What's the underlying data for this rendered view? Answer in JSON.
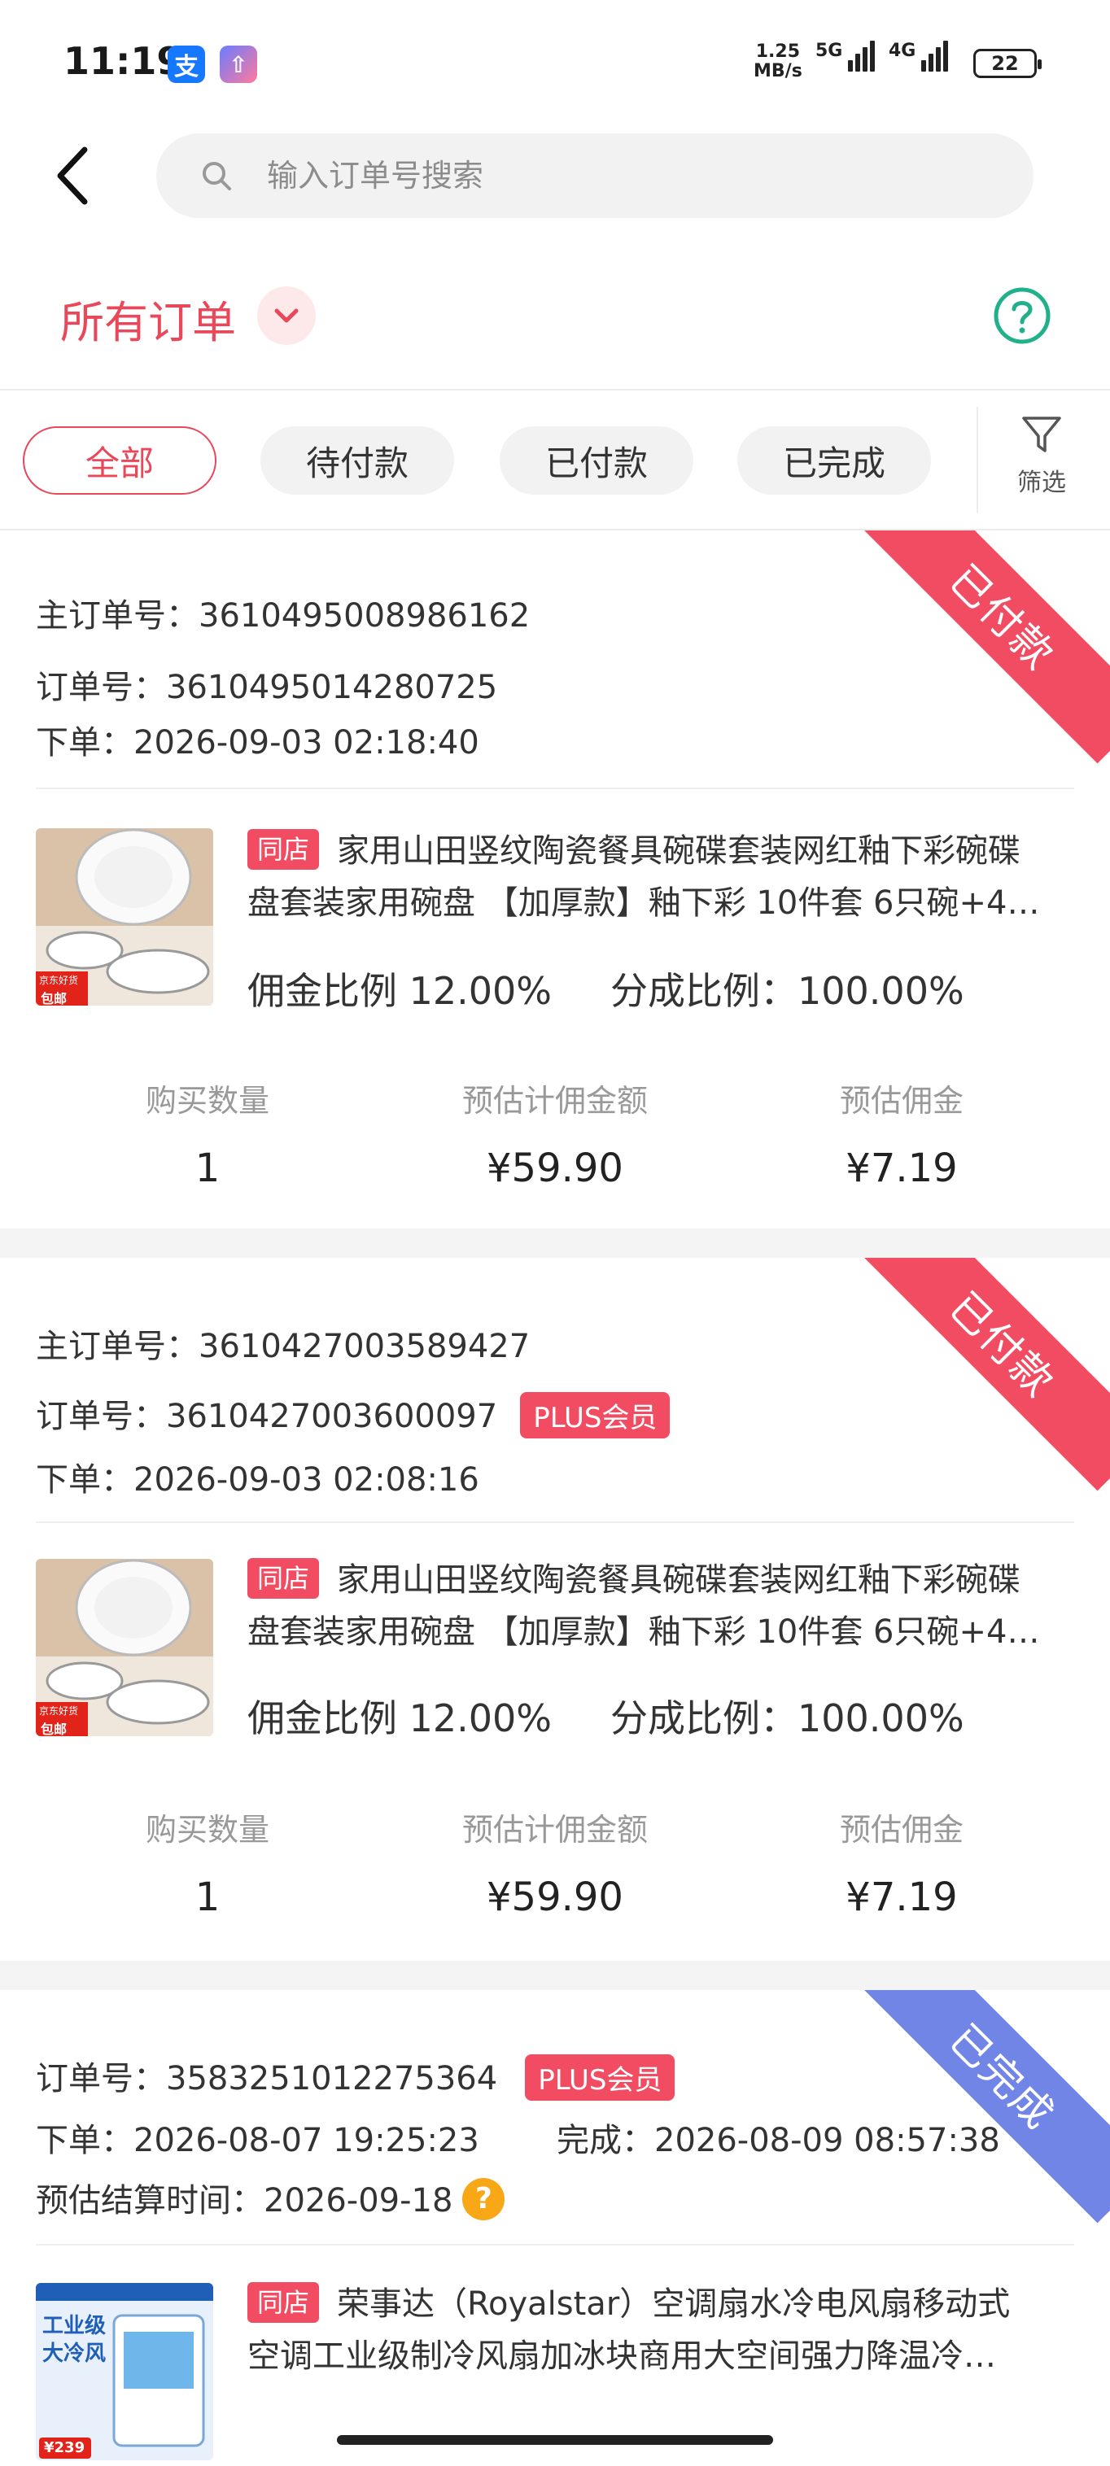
{
  "status_bar": {
    "time": "11:19",
    "alipay_icon_glyph": "支",
    "upload_icon_glyph": "⇧",
    "net_speed_value": "1.25",
    "net_speed_unit": "MB/s",
    "signal1_label": "5G",
    "signal2_label": "4G",
    "battery": "22"
  },
  "search": {
    "placeholder": "输入订单号搜索"
  },
  "header": {
    "title": "所有订单"
  },
  "tabs": [
    {
      "label": "全部",
      "active": true
    },
    {
      "label": "待付款",
      "active": false
    },
    {
      "label": "已付款",
      "active": false
    },
    {
      "label": "已完成",
      "active": false
    }
  ],
  "filter": {
    "label": "筛选"
  },
  "orders": [
    {
      "status": "已付款",
      "main_order": "主订单号：3610495008986162",
      "order_no": "订单号：3610495014280725",
      "placed": "下单：2026-09-03 02:18:40",
      "shop_tag": "同店",
      "product_line1": "家用山田竖纹陶瓷餐具碗碟套装网红釉下彩碗碟",
      "product_line2": "盘套装家用碗盘 【加厚款】釉下彩 10件套 6只碗+4…",
      "thumb_badge_1": "京东好货",
      "thumb_badge_2": "包邮",
      "commission_rate": "佣金比例 12.00%",
      "share_rate": "分成比例：100.00%",
      "stat_labels": [
        "购买数量",
        "预估计佣金额",
        "预估佣金"
      ],
      "stat_values": [
        "1",
        "¥59.90",
        "¥7.19"
      ]
    },
    {
      "status": "已付款",
      "main_order": "主订单号：3610427003589427",
      "order_no": "订单号：3610427003600097",
      "plus_badge": "PLUS会员",
      "placed": "下单：2026-09-03 02:08:16",
      "shop_tag": "同店",
      "product_line1": "家用山田竖纹陶瓷餐具碗碟套装网红釉下彩碗碟",
      "product_line2": "盘套装家用碗盘 【加厚款】釉下彩 10件套 6只碗+4…",
      "thumb_badge_1": "京东好货",
      "thumb_badge_2": "包邮",
      "commission_rate": "佣金比例 12.00%",
      "share_rate": "分成比例：100.00%",
      "stat_labels": [
        "购买数量",
        "预估计佣金额",
        "预估佣金"
      ],
      "stat_values": [
        "1",
        "¥59.90",
        "¥7.19"
      ]
    },
    {
      "status": "已完成",
      "order_no": "订单号：3583251012275364",
      "plus_badge": "PLUS会员",
      "placed": "下单：2026-08-07 19:25:23",
      "completed": "完成：2026-08-09 08:57:38",
      "settle_time": "预估结算时间：2026-09-18",
      "settle_help_glyph": "?",
      "shop_tag": "同店",
      "product_line1": "荣事达（Royalstar）空调扇水冷电风扇移动式",
      "product_line2": "空调工业级制冷风扇加冰块商用大空间强力降温冷…",
      "thumb_badge_1": "工业级",
      "thumb_badge_2": "大冷风",
      "thumb_badge_3": "¥239"
    }
  ],
  "colors": {
    "accent_red": "#e8485a",
    "ribbon_paid": "#f24c62",
    "ribbon_done": "#7185e6",
    "help_green": "#21b08c",
    "help_orange": "#f8a716"
  }
}
